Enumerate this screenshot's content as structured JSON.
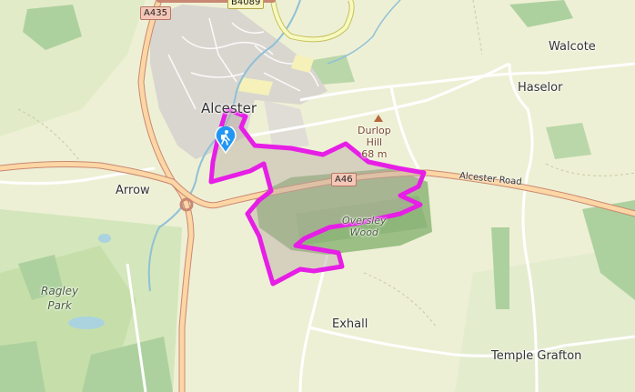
{
  "map": {
    "places": {
      "alcester": "Alcester",
      "walcote": "Walcote",
      "haselor": "Haselor",
      "arrow": "Arrow",
      "exhall": "Exhall",
      "temple_grafton": "Temple Grafton"
    },
    "hill": {
      "name1": "Durlop",
      "name2": "Hill",
      "elevation": "68 m"
    },
    "woods": {
      "line1": "Oversley",
      "line2": "Wood"
    },
    "park": {
      "line1": "Ragley",
      "line2": "Park"
    },
    "roads": {
      "a435": "A435",
      "b4089": "B4089",
      "a46": "A46",
      "alcester_road": "Alcester Road"
    },
    "route_color": "#e61ee6",
    "marker_icon": "hiker-icon",
    "marker_color": "#2196f3"
  }
}
